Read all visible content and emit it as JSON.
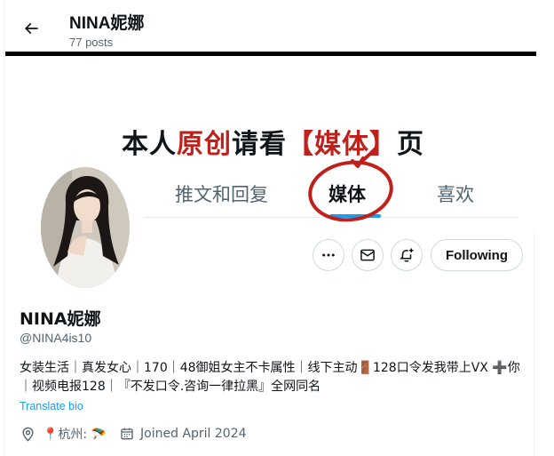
{
  "header": {
    "title": "NINA妮娜",
    "posts_count": "77 posts"
  },
  "banner": {
    "headline_parts": [
      "本人",
      "原创",
      "请看",
      "【媒体】",
      "页"
    ],
    "tabs": [
      "推文和回复",
      "媒体",
      "喜欢"
    ],
    "accent_red": "#c0201c",
    "underline_blue": "#1d9bf0"
  },
  "actions": {
    "more_icon": "more-horizontal-icon",
    "message_icon": "envelope-icon",
    "notify_icon": "bell-plus-icon",
    "following_label": "Following"
  },
  "profile": {
    "display_name": "NINA妮娜",
    "handle": "@NINA4is10",
    "bio": "女装生活｜真发女心｜170｜48御姐女主不卡属性｜线下主动🚪128口令发我带上VX ➕你｜视频电报128｜『不发口令.咨询一律拉黑』全网同名",
    "translate_label": "Translate bio",
    "location": "📍杭州: 🪂",
    "joined": "Joined April 2024"
  },
  "colors": {
    "text_primary": "#0f1419",
    "text_secondary": "#536471",
    "link": "#1d9bf0",
    "border": "#cfd9de"
  }
}
